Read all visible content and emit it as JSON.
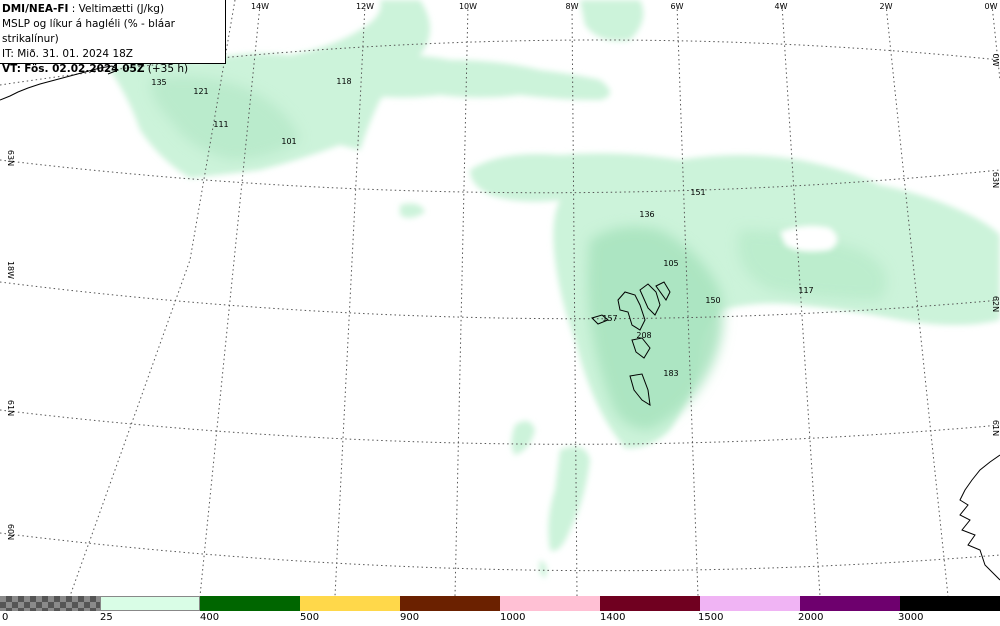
{
  "header": {
    "model": "DMI/NEA-FI",
    "parameter": ": Veltimætti (J/kg)",
    "line2": "MSLP og líkur á hagléli (% - bláar strikalínur)",
    "line3": "IT: Mið. 31. 01. 2024 18Z",
    "vt_label": "VT:",
    "vt_value": "Fös. 02.02.2024 05Z",
    "lead": "(+35 h)"
  },
  "longitude_labels": [
    "14W",
    "12W",
    "10W",
    "8W",
    "6W",
    "4W",
    "2W",
    "0W"
  ],
  "latitude_labels_left": [
    "63N",
    "18W",
    "61N",
    "60N"
  ],
  "latitude_labels_right": [
    "0W",
    "63N",
    "62N",
    "61N"
  ],
  "cape_values": [
    "135",
    "121",
    "118",
    "111",
    "101",
    "151",
    "136",
    "105",
    "150",
    "117",
    "157",
    "208",
    "183"
  ],
  "colorbar": {
    "colors": [
      "#9a9a9a",
      "#d9fde6",
      "#006600",
      "#ffd84a",
      "#6b2100",
      "#ffc0d4",
      "#700020",
      "#f0b4f4",
      "#6e006e",
      "#000000"
    ],
    "ticks": [
      "0",
      "25",
      "400",
      "500",
      "900",
      "1000",
      "1400",
      "1500",
      "2000",
      "3000"
    ]
  }
}
